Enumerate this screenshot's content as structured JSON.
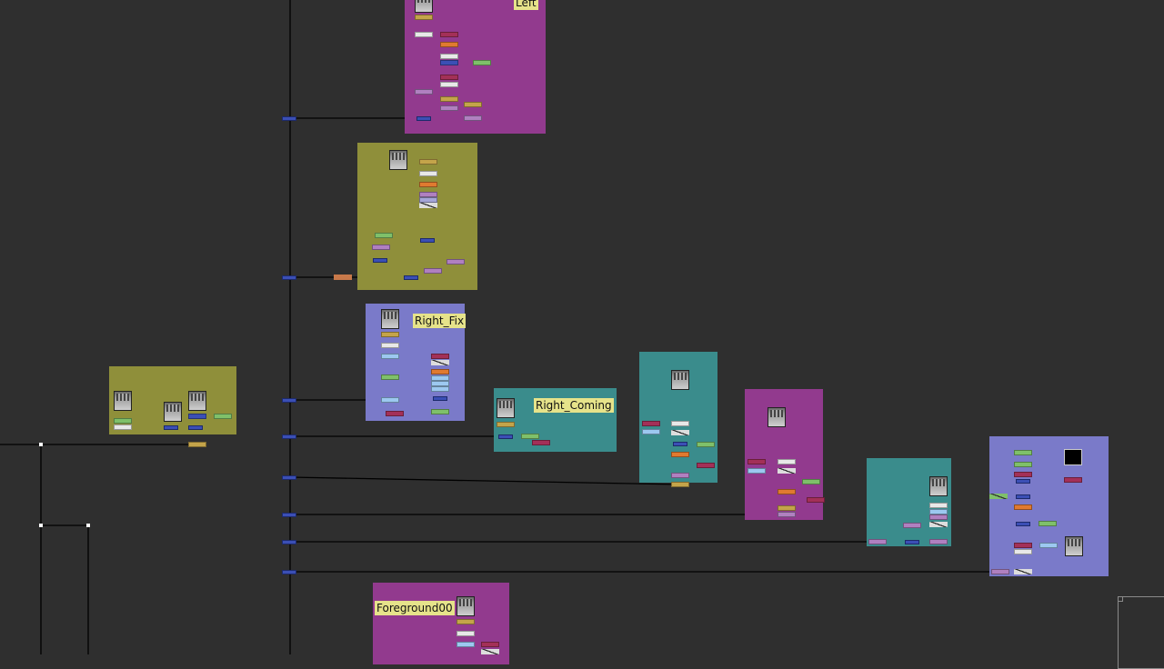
{
  "app": {
    "view": "node-graph",
    "background_color": "#2f2f2f"
  },
  "backdrops": [
    {
      "id": "left",
      "label": "Left",
      "color": "#923a8e"
    },
    {
      "id": "olive-top",
      "label": "",
      "color": "#8f8f3a"
    },
    {
      "id": "right-fix",
      "label": "Right_Fix",
      "color": "#7a7ac9"
    },
    {
      "id": "olive-left",
      "label": "",
      "color": "#8f8f3a"
    },
    {
      "id": "right-coming",
      "label": "Right_Coming",
      "color": "#3a8c8c"
    },
    {
      "id": "teal-mid",
      "label": "",
      "color": "#3a8c8c"
    },
    {
      "id": "magenta-mid",
      "label": "",
      "color": "#923a8e"
    },
    {
      "id": "teal-right",
      "label": "",
      "color": "#3a8c8c"
    },
    {
      "id": "blue-right",
      "label": "",
      "color": "#7a7ac9"
    },
    {
      "id": "foreground",
      "label": "Foreground00",
      "color": "#923a8e"
    }
  ],
  "node_colors": {
    "merge": "#a33058",
    "grade": "#c4a44a",
    "blur": "#7fc06a",
    "transform": "#a5a5d8",
    "dot": "#3b4fb5",
    "viewer": "#c8794a",
    "roto": "#b080c0",
    "white": "#e8e8e8",
    "orange": "#e07a30",
    "light": "#9cc8f0"
  }
}
